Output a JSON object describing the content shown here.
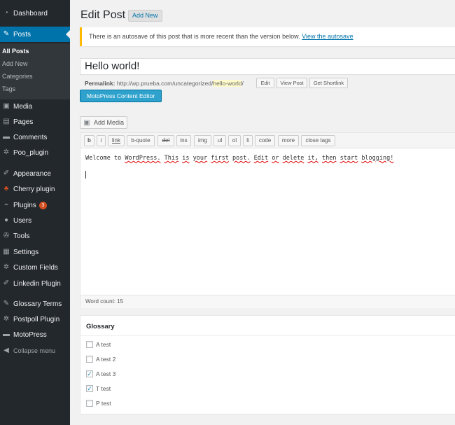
{
  "sidebar": {
    "items": [
      {
        "label": "Dashboard",
        "icon": "dashboard-icon",
        "glyph": "◔"
      },
      {
        "label": "Posts",
        "icon": "pin-icon",
        "glyph": "✎"
      },
      {
        "label": "Media",
        "icon": "media-icon",
        "glyph": "▣"
      },
      {
        "label": "Pages",
        "icon": "pages-icon",
        "glyph": "▤"
      },
      {
        "label": "Comments",
        "icon": "comments-icon",
        "glyph": "▬"
      },
      {
        "label": "Poo_plugin",
        "icon": "gear-icon",
        "glyph": "✲"
      },
      {
        "label": "Appearance",
        "icon": "appearance-icon",
        "glyph": "✐"
      },
      {
        "label": "Cherry plugin",
        "icon": "cherry-icon",
        "glyph": "♣"
      },
      {
        "label": "Plugins",
        "icon": "plugins-icon",
        "glyph": "⌁",
        "badge": "3"
      },
      {
        "label": "Users",
        "icon": "users-icon",
        "glyph": "●"
      },
      {
        "label": "Tools",
        "icon": "tools-icon",
        "glyph": "✇"
      },
      {
        "label": "Settings",
        "icon": "settings-icon",
        "glyph": "▦"
      },
      {
        "label": "Custom Fields",
        "icon": "custom-fields-icon",
        "glyph": "✲"
      },
      {
        "label": "Linkedin Plugin",
        "icon": "linkedin-icon",
        "glyph": "✐"
      },
      {
        "label": "Glossary Terms",
        "icon": "glossary-icon",
        "glyph": "✎"
      },
      {
        "label": "Postpoll Plugin",
        "icon": "postpoll-icon",
        "glyph": "✲"
      },
      {
        "label": "MotoPress",
        "icon": "motopress-icon",
        "glyph": "▬"
      }
    ],
    "posts_submenu": [
      "All Posts",
      "Add New",
      "Categories",
      "Tags"
    ],
    "collapse_label": "Collapse menu"
  },
  "header": {
    "title": "Edit Post",
    "add_new": "Add New"
  },
  "notice": {
    "text": "There is an autosave of this post that is more recent than the version below.",
    "link": "View the autosave",
    "accent_color": "#ffba00"
  },
  "post": {
    "title": "Hello world!",
    "permalink_label": "Permalink:",
    "permalink_base": "http://wp.prueba.com/uncategorized/",
    "permalink_slug": "hello-world",
    "permalink_end": "/",
    "buttons": [
      "Edit",
      "View Post",
      "Get Shortlink"
    ],
    "motopress_button": "MotoPress Content Editor"
  },
  "editor": {
    "add_media": "Add Media",
    "toolbar": [
      "b",
      "i",
      "link",
      "b-quote",
      "del",
      "ins",
      "img",
      "ul",
      "ol",
      "li",
      "code",
      "more",
      "close tags"
    ],
    "content_words": [
      "Welcome",
      "to",
      "WordPress.",
      "This",
      "is",
      "your",
      "first",
      "post.",
      "Edit",
      "or",
      "delete",
      "it,",
      "then",
      "start",
      "blogging!"
    ],
    "word_count": "Word count: 15"
  },
  "glossary": {
    "title": "Glossary",
    "items": [
      {
        "label": "A test",
        "checked": false
      },
      {
        "label": "A test 2",
        "checked": false
      },
      {
        "label": "A test 3",
        "checked": true
      },
      {
        "label": "T test",
        "checked": true
      },
      {
        "label": "P test",
        "checked": false
      }
    ]
  },
  "colors": {
    "sidebar_bg": "#23282d",
    "active_blue": "#0073aa",
    "motopress_blue": "#2ea2cc",
    "badge_orange": "#d54e21"
  }
}
